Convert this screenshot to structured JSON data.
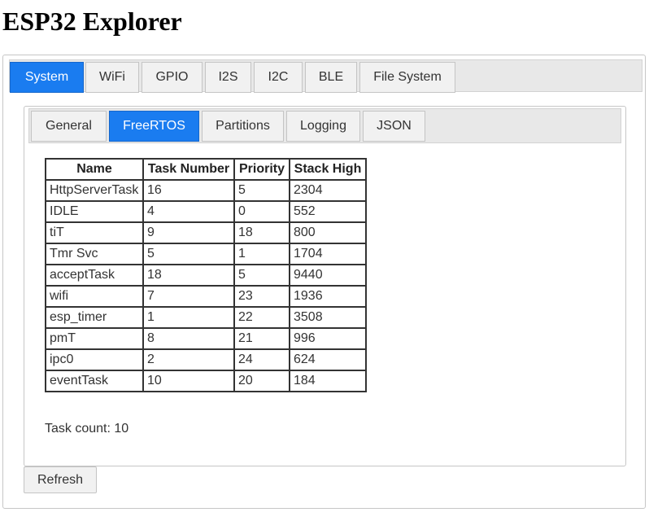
{
  "app": {
    "title": "ESP32 Explorer"
  },
  "main_tabs": [
    {
      "label": "System",
      "active": true
    },
    {
      "label": "WiFi",
      "active": false
    },
    {
      "label": "GPIO",
      "active": false
    },
    {
      "label": "I2S",
      "active": false
    },
    {
      "label": "I2C",
      "active": false
    },
    {
      "label": "BLE",
      "active": false
    },
    {
      "label": "File System",
      "active": false
    }
  ],
  "sub_tabs": [
    {
      "label": "General",
      "active": false
    },
    {
      "label": "FreeRTOS",
      "active": true
    },
    {
      "label": "Partitions",
      "active": false
    },
    {
      "label": "Logging",
      "active": false
    },
    {
      "label": "JSON",
      "active": false
    }
  ],
  "task_table": {
    "headers": [
      "Name",
      "Task Number",
      "Priority",
      "Stack High"
    ],
    "rows": [
      [
        "HttpServerTask",
        "16",
        "5",
        "2304"
      ],
      [
        "IDLE",
        "4",
        "0",
        "552"
      ],
      [
        "tiT",
        "9",
        "18",
        "800"
      ],
      [
        "Tmr Svc",
        "5",
        "1",
        "1704"
      ],
      [
        "acceptTask",
        "18",
        "5",
        "9440"
      ],
      [
        "wifi",
        "7",
        "23",
        "1936"
      ],
      [
        "esp_timer",
        "1",
        "22",
        "3508"
      ],
      [
        "pmT",
        "8",
        "21",
        "996"
      ],
      [
        "ipc0",
        "2",
        "24",
        "624"
      ],
      [
        "eventTask",
        "10",
        "20",
        "184"
      ]
    ]
  },
  "task_count_text": "Task count: 10",
  "refresh_label": "Refresh",
  "colors": {
    "active_tab": "#1a7cf0",
    "inactive_tab": "#f1f1f1",
    "tabbar": "#e8e8e8"
  }
}
